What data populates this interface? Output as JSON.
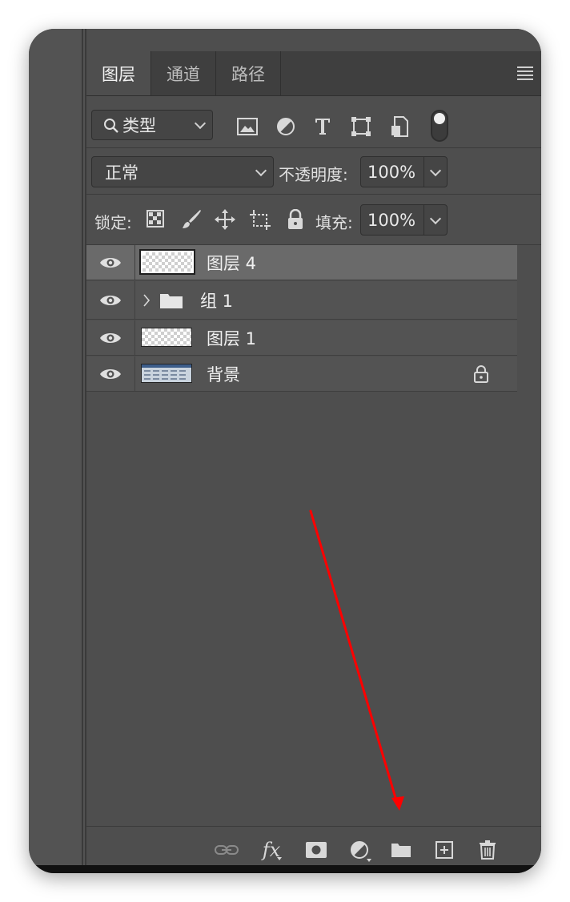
{
  "tabs": [
    {
      "label": "图层"
    },
    {
      "label": "通道"
    },
    {
      "label": "路径"
    }
  ],
  "filter": {
    "kind_label": "类型",
    "icons": [
      "image-filter-icon",
      "adjustment-filter-icon",
      "type-filter-icon",
      "shape-filter-icon",
      "smart-object-filter-icon",
      "filter-toggle-icon"
    ]
  },
  "blend": {
    "mode": "正常",
    "opacity_label": "不透明度:",
    "opacity_value": "100%"
  },
  "lock": {
    "label": "锁定:",
    "fill_label": "填充:",
    "fill_value": "100%"
  },
  "layers": [
    {
      "name": "图层 4",
      "selected": true,
      "type": "pixel"
    },
    {
      "name": "组 1",
      "selected": false,
      "type": "group"
    },
    {
      "name": "图层 1",
      "selected": false,
      "type": "pixel"
    },
    {
      "name": "背景",
      "selected": false,
      "type": "background",
      "locked": true
    }
  ],
  "bottom_icons": [
    "link-layers-icon",
    "fx-icon",
    "layer-mask-icon",
    "adjustment-layer-icon",
    "new-group-icon",
    "new-layer-icon",
    "delete-layer-icon"
  ],
  "bottom_text": {
    "fx": "fx"
  },
  "annotation_color": "#ff0000"
}
